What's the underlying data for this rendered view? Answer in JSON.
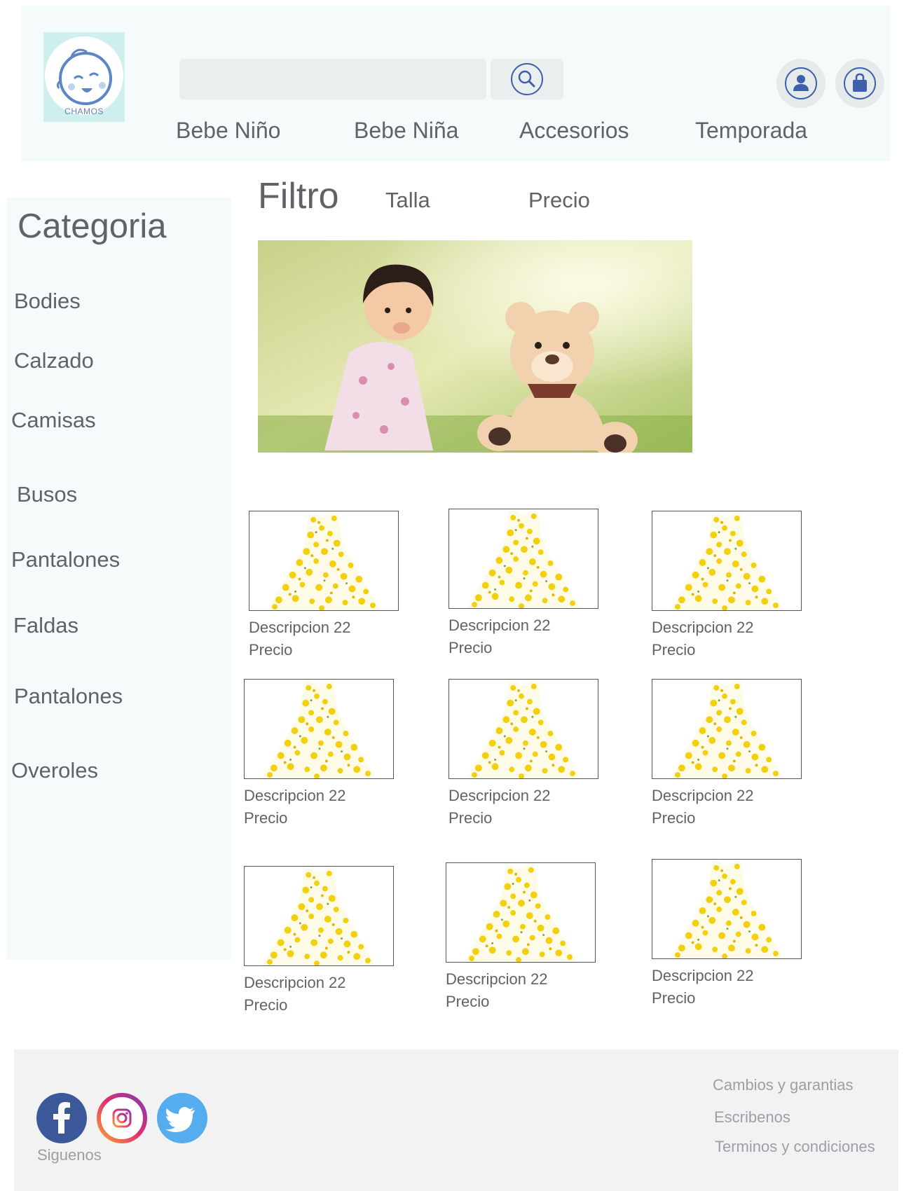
{
  "header": {
    "logo_text": "CHAMOS",
    "search": {
      "value": "",
      "placeholder": ""
    },
    "nav": [
      "Bebe Niño",
      "Bebe Niña",
      "Accesorios",
      "Temporada"
    ]
  },
  "sidebar": {
    "title": "Categoria",
    "items": [
      "Bodies",
      "Calzado",
      "Camisas",
      "Busos",
      "Pantalones",
      "Faldas",
      "Pantalones",
      "Overoles"
    ]
  },
  "filter": {
    "title": "Filtro",
    "options": [
      "Talla",
      "Precio"
    ]
  },
  "products": [
    {
      "description": "Descripcion 22",
      "price": "Precio"
    },
    {
      "description": "Descripcion 22",
      "price": "Precio"
    },
    {
      "description": "Descripcion 22",
      "price": "Precio"
    },
    {
      "description": "Descripcion 22",
      "price": "Precio"
    },
    {
      "description": "Descripcion 22",
      "price": "Precio"
    },
    {
      "description": "Descripcion 22",
      "price": "Precio"
    },
    {
      "description": "Descripcion 22",
      "price": "Precio"
    },
    {
      "description": "Descripcion 22",
      "price": "Precio"
    },
    {
      "description": "Descripcion 22",
      "price": "Precio"
    }
  ],
  "footer": {
    "follow_label": "Siguenos",
    "links": [
      "Cambios y garantias",
      "Escribenos",
      "Terminos y condiciones"
    ]
  },
  "colors": {
    "header_bg": "#f5fafa",
    "footer_bg": "#f2f2f2",
    "icon_blue": "#3f5fae",
    "facebook": "#3b5998",
    "twitter": "#55acee"
  }
}
